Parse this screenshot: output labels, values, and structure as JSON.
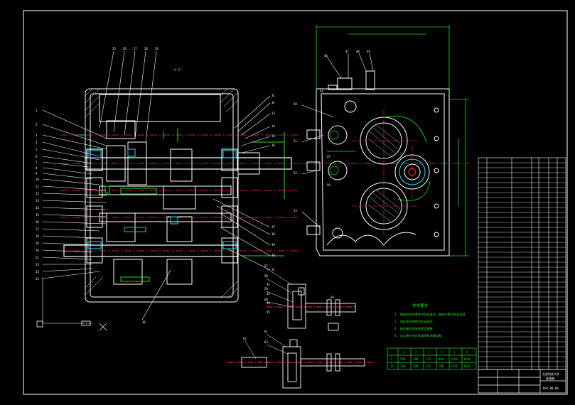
{
  "drawing": {
    "view_label": "A-A",
    "part_numbers_left": [
      "1",
      "2",
      "3",
      "4",
      "5",
      "6",
      "7",
      "8",
      "9",
      "10",
      "11",
      "12",
      "13",
      "14",
      "15",
      "16",
      "17",
      "18",
      "19",
      "20",
      "21",
      "22",
      "23",
      "24",
      "25",
      "26",
      "27",
      "28",
      "29",
      "30"
    ],
    "part_numbers_right": [
      "31",
      "32",
      "33",
      "34",
      "35",
      "36",
      "37",
      "38",
      "39",
      "40",
      "41",
      "42",
      "43",
      "44",
      "45"
    ],
    "top_callouts": [
      "46",
      "47",
      "48",
      "49"
    ],
    "side_callouts": [
      "50",
      "51",
      "52",
      "53",
      "54",
      "55",
      "56"
    ],
    "detail_callouts": [
      "57",
      "58",
      "59",
      "60",
      "61",
      "62",
      "63",
      "64"
    ]
  },
  "technical_requirements": {
    "title": "技术要求",
    "items": [
      "1. 装配前所有零件用煤油清洗，箱体内壁涂耐油油漆",
      "2. 齿轮啮合侧隙用铅丝检验",
      "3. 轴承轴向游隙按规定调整",
      "4. 试运转时无异常噪声和渗漏现象"
    ]
  },
  "speed_table": {
    "header": [
      "",
      "1",
      "2",
      "3",
      "4",
      "5",
      "6"
    ],
    "rows": [
      [
        "I",
        "550",
        "280",
        "175",
        "860",
        "1450",
        "1010"
      ],
      [
        "II",
        "240",
        "200",
        "125",
        "780",
        "1420",
        "1020"
      ]
    ]
  },
  "title_block": {
    "school": "太原科技大学",
    "drawing_name": "变速箱",
    "drawing_number": "BSX-00-00"
  },
  "colors": {
    "background": "#000000",
    "outline": "#ffffff",
    "centerline": "#ff3333",
    "dimension": "#22dd22",
    "hidden": "#ffff33",
    "highlight": "#00e5ff"
  }
}
